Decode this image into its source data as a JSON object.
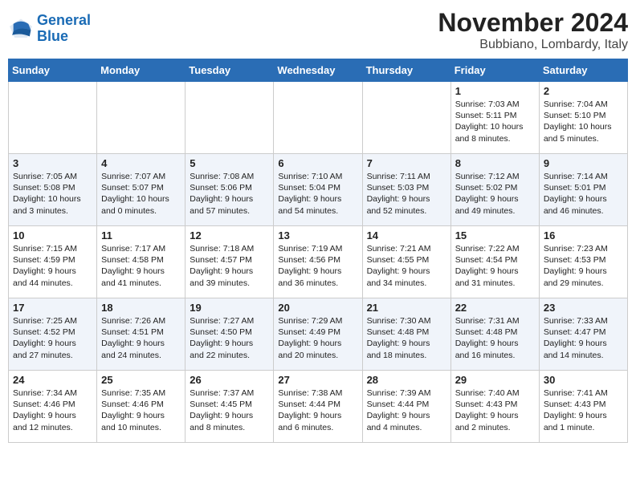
{
  "logo": {
    "line1": "General",
    "line2": "Blue"
  },
  "title": "November 2024",
  "subtitle": "Bubbiano, Lombardy, Italy",
  "days_of_week": [
    "Sunday",
    "Monday",
    "Tuesday",
    "Wednesday",
    "Thursday",
    "Friday",
    "Saturday"
  ],
  "weeks": [
    [
      {
        "day": "",
        "info": ""
      },
      {
        "day": "",
        "info": ""
      },
      {
        "day": "",
        "info": ""
      },
      {
        "day": "",
        "info": ""
      },
      {
        "day": "",
        "info": ""
      },
      {
        "day": "1",
        "info": "Sunrise: 7:03 AM\nSunset: 5:11 PM\nDaylight: 10 hours and 8 minutes."
      },
      {
        "day": "2",
        "info": "Sunrise: 7:04 AM\nSunset: 5:10 PM\nDaylight: 10 hours and 5 minutes."
      }
    ],
    [
      {
        "day": "3",
        "info": "Sunrise: 7:05 AM\nSunset: 5:08 PM\nDaylight: 10 hours and 3 minutes."
      },
      {
        "day": "4",
        "info": "Sunrise: 7:07 AM\nSunset: 5:07 PM\nDaylight: 10 hours and 0 minutes."
      },
      {
        "day": "5",
        "info": "Sunrise: 7:08 AM\nSunset: 5:06 PM\nDaylight: 9 hours and 57 minutes."
      },
      {
        "day": "6",
        "info": "Sunrise: 7:10 AM\nSunset: 5:04 PM\nDaylight: 9 hours and 54 minutes."
      },
      {
        "day": "7",
        "info": "Sunrise: 7:11 AM\nSunset: 5:03 PM\nDaylight: 9 hours and 52 minutes."
      },
      {
        "day": "8",
        "info": "Sunrise: 7:12 AM\nSunset: 5:02 PM\nDaylight: 9 hours and 49 minutes."
      },
      {
        "day": "9",
        "info": "Sunrise: 7:14 AM\nSunset: 5:01 PM\nDaylight: 9 hours and 46 minutes."
      }
    ],
    [
      {
        "day": "10",
        "info": "Sunrise: 7:15 AM\nSunset: 4:59 PM\nDaylight: 9 hours and 44 minutes."
      },
      {
        "day": "11",
        "info": "Sunrise: 7:17 AM\nSunset: 4:58 PM\nDaylight: 9 hours and 41 minutes."
      },
      {
        "day": "12",
        "info": "Sunrise: 7:18 AM\nSunset: 4:57 PM\nDaylight: 9 hours and 39 minutes."
      },
      {
        "day": "13",
        "info": "Sunrise: 7:19 AM\nSunset: 4:56 PM\nDaylight: 9 hours and 36 minutes."
      },
      {
        "day": "14",
        "info": "Sunrise: 7:21 AM\nSunset: 4:55 PM\nDaylight: 9 hours and 34 minutes."
      },
      {
        "day": "15",
        "info": "Sunrise: 7:22 AM\nSunset: 4:54 PM\nDaylight: 9 hours and 31 minutes."
      },
      {
        "day": "16",
        "info": "Sunrise: 7:23 AM\nSunset: 4:53 PM\nDaylight: 9 hours and 29 minutes."
      }
    ],
    [
      {
        "day": "17",
        "info": "Sunrise: 7:25 AM\nSunset: 4:52 PM\nDaylight: 9 hours and 27 minutes."
      },
      {
        "day": "18",
        "info": "Sunrise: 7:26 AM\nSunset: 4:51 PM\nDaylight: 9 hours and 24 minutes."
      },
      {
        "day": "19",
        "info": "Sunrise: 7:27 AM\nSunset: 4:50 PM\nDaylight: 9 hours and 22 minutes."
      },
      {
        "day": "20",
        "info": "Sunrise: 7:29 AM\nSunset: 4:49 PM\nDaylight: 9 hours and 20 minutes."
      },
      {
        "day": "21",
        "info": "Sunrise: 7:30 AM\nSunset: 4:48 PM\nDaylight: 9 hours and 18 minutes."
      },
      {
        "day": "22",
        "info": "Sunrise: 7:31 AM\nSunset: 4:48 PM\nDaylight: 9 hours and 16 minutes."
      },
      {
        "day": "23",
        "info": "Sunrise: 7:33 AM\nSunset: 4:47 PM\nDaylight: 9 hours and 14 minutes."
      }
    ],
    [
      {
        "day": "24",
        "info": "Sunrise: 7:34 AM\nSunset: 4:46 PM\nDaylight: 9 hours and 12 minutes."
      },
      {
        "day": "25",
        "info": "Sunrise: 7:35 AM\nSunset: 4:46 PM\nDaylight: 9 hours and 10 minutes."
      },
      {
        "day": "26",
        "info": "Sunrise: 7:37 AM\nSunset: 4:45 PM\nDaylight: 9 hours and 8 minutes."
      },
      {
        "day": "27",
        "info": "Sunrise: 7:38 AM\nSunset: 4:44 PM\nDaylight: 9 hours and 6 minutes."
      },
      {
        "day": "28",
        "info": "Sunrise: 7:39 AM\nSunset: 4:44 PM\nDaylight: 9 hours and 4 minutes."
      },
      {
        "day": "29",
        "info": "Sunrise: 7:40 AM\nSunset: 4:43 PM\nDaylight: 9 hours and 2 minutes."
      },
      {
        "day": "30",
        "info": "Sunrise: 7:41 AM\nSunset: 4:43 PM\nDaylight: 9 hours and 1 minute."
      }
    ]
  ]
}
